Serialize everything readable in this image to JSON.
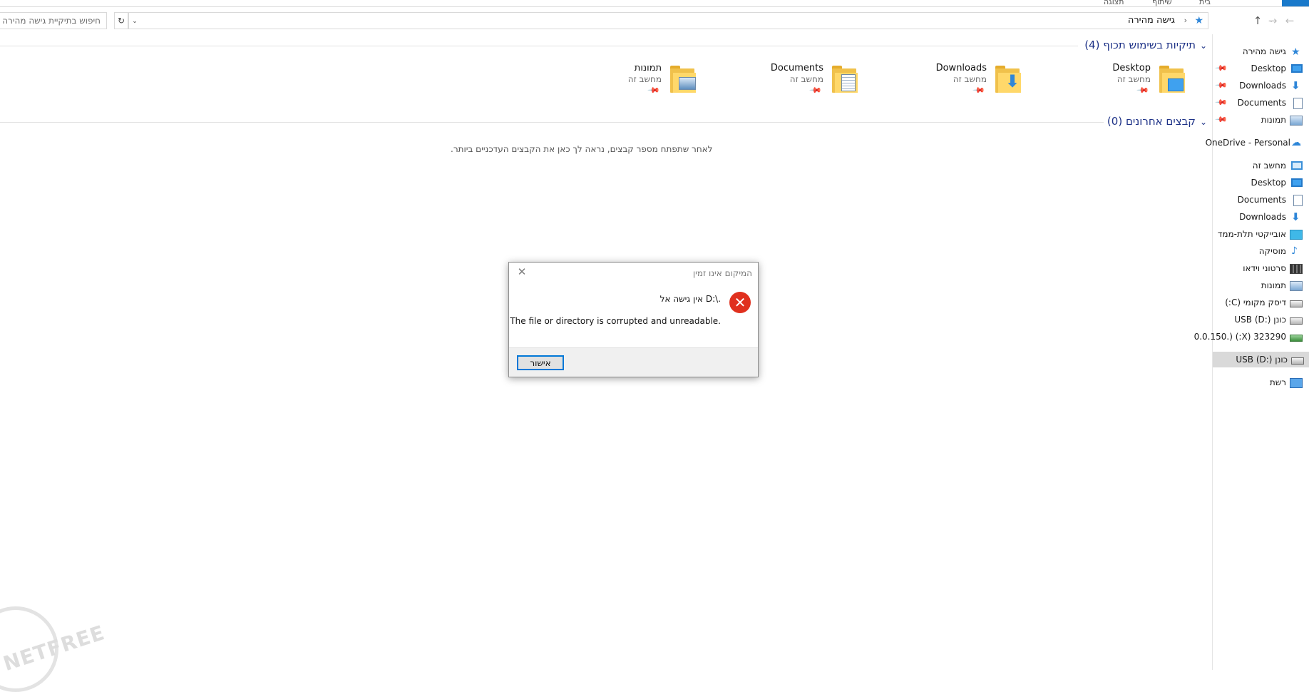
{
  "ribbon": {
    "tabs": [
      "בית",
      "שיתוף",
      "תצוגה"
    ]
  },
  "address_bar": {
    "path": "גישה מהירה",
    "separator": "›",
    "search_placeholder": "חיפוש בתיקיית גישה מהירה"
  },
  "nav_pane": {
    "items": [
      {
        "label": "גישה מהירה",
        "icon": "star-icon"
      },
      {
        "label": "Desktop",
        "icon": "desktop-icon",
        "pinned": true
      },
      {
        "label": "Downloads",
        "icon": "download-arrow-icon",
        "pinned": true
      },
      {
        "label": "Documents",
        "icon": "document-icon",
        "pinned": true
      },
      {
        "label": "תמונות",
        "icon": "pictures-icon",
        "pinned": true
      },
      {
        "label": "OneDrive - Personal",
        "icon": "cloud-icon"
      },
      {
        "label": "מחשב זה",
        "icon": "computer-icon"
      },
      {
        "label": "Desktop",
        "icon": "desktop-icon"
      },
      {
        "label": "Documents",
        "icon": "document-icon"
      },
      {
        "label": "Downloads",
        "icon": "download-arrow-icon"
      },
      {
        "label": "אובייקטי תלת-ממד",
        "icon": "3d-objects-icon"
      },
      {
        "label": "מוסיקה",
        "icon": "music-note-icon"
      },
      {
        "label": "סרטוני וידאו",
        "icon": "video-film-icon"
      },
      {
        "label": "תמונות",
        "icon": "pictures-icon"
      },
      {
        "label": "דיסק מקומי (C:)",
        "icon": "local-disk-icon"
      },
      {
        "label": "כונן USB (D:)",
        "icon": "usb-drive-icon"
      },
      {
        "label": "323290 (X:) (.0.0.150",
        "icon": "network-drive-icon"
      },
      {
        "label": "כונן USB (D:)",
        "icon": "usb-drive-icon",
        "selected": true
      },
      {
        "label": "רשת",
        "icon": "network-icon"
      }
    ]
  },
  "frequent_folders": {
    "header": "תיקיות בשימוש תכוף (4)",
    "folders": [
      {
        "name": "Desktop",
        "location": "מחשב זה"
      },
      {
        "name": "Downloads",
        "location": "מחשב זה"
      },
      {
        "name": "Documents",
        "location": "מחשב זה"
      },
      {
        "name": "תמונות",
        "location": "מחשב זה"
      }
    ]
  },
  "recent_files": {
    "header": "קבצים אחרונים (0)",
    "empty_message": "לאחר שתפתח מספר קבצים, נראה לך כאן את הקבצים העדכניים ביותר."
  },
  "dialog": {
    "title": "המיקום אינו זמין",
    "message_line1": "אין גישה אל D:\\.",
    "message_line2": "The file or directory is corrupted and unreadable.",
    "ok_label": "אישור",
    "close_glyph": "✕"
  },
  "watermark": {
    "text": "NETFREE"
  },
  "colors": {
    "accent": "#1979ca",
    "group_header": "#1e3287",
    "error_red": "#e0301e",
    "selected_nav": "#d9d9d9"
  }
}
